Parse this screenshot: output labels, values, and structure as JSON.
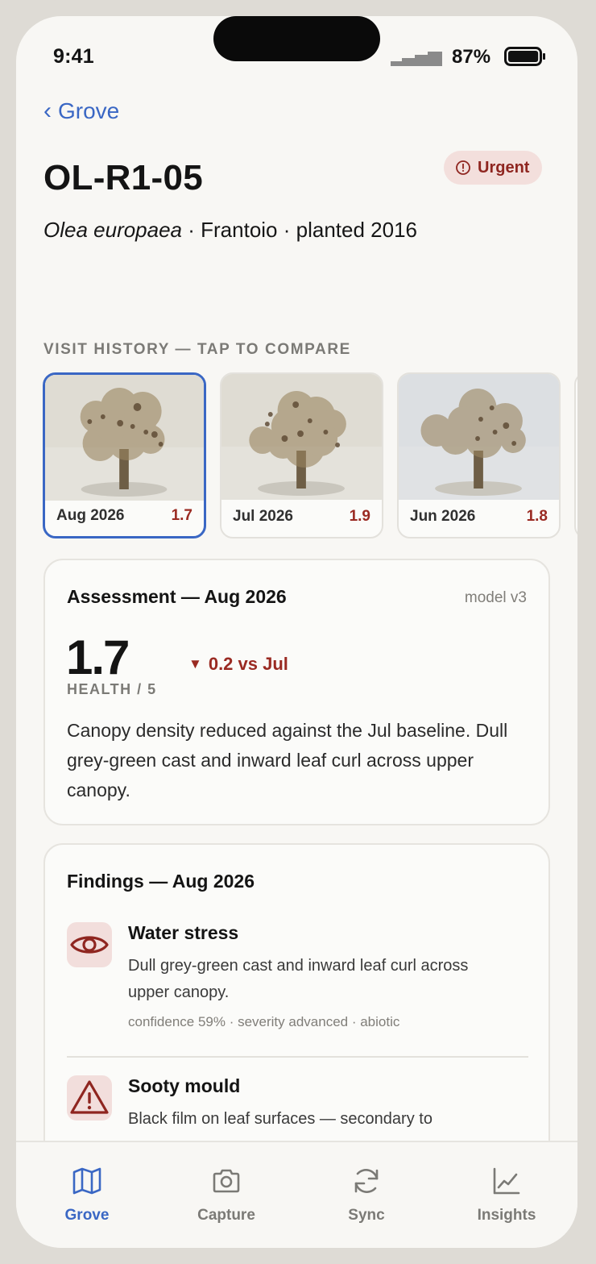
{
  "status_bar": {
    "time": "9:41",
    "battery_percent": "87%",
    "battery_level": 0.87
  },
  "nav": {
    "back_label": "Grove"
  },
  "tree": {
    "id": "OL-R1-05",
    "species": "Olea europaea",
    "details": " · Frantoio · planted 2016",
    "badge": "Urgent"
  },
  "visit_history": {
    "label": "VISIT HISTORY — TAP TO COMPARE",
    "visits": [
      {
        "date": "Aug 2026",
        "score": "1.7",
        "selected": true
      },
      {
        "date": "Jul 2026",
        "score": "1.9",
        "selected": false
      },
      {
        "date": "Jun 2026",
        "score": "1.8",
        "selected": false
      }
    ]
  },
  "assessment": {
    "title": "Assessment — Aug 2026",
    "model": "model v3",
    "score": "1.7",
    "delta": "0.2 vs Jul",
    "score_label": "HEALTH / 5",
    "description": "Canopy density reduced against the Jul baseline. Dull grey-green cast and inward leaf curl across upper canopy."
  },
  "findings": {
    "title": "Findings — Aug 2026",
    "items": [
      {
        "icon": "eye-icon",
        "name": "Water stress",
        "description": "Dull grey-green cast and inward leaf curl across upper canopy.",
        "meta": "confidence 59% · severity advanced · abiotic"
      },
      {
        "icon": "warning-icon",
        "name": "Sooty mould",
        "description": "Black film on leaf surfaces — secondary to",
        "meta": ""
      }
    ]
  },
  "tab_bar": {
    "tabs": [
      {
        "label": "Grove",
        "icon": "map-icon",
        "active": true
      },
      {
        "label": "Capture",
        "icon": "camera-icon",
        "active": false
      },
      {
        "label": "Sync",
        "icon": "sync-icon",
        "active": false
      },
      {
        "label": "Insights",
        "icon": "chart-icon",
        "active": false
      }
    ]
  },
  "colors": {
    "accent": "#3a67c4",
    "urgent": "#9a2a22",
    "urgent_bg": "#f3dfdc"
  }
}
